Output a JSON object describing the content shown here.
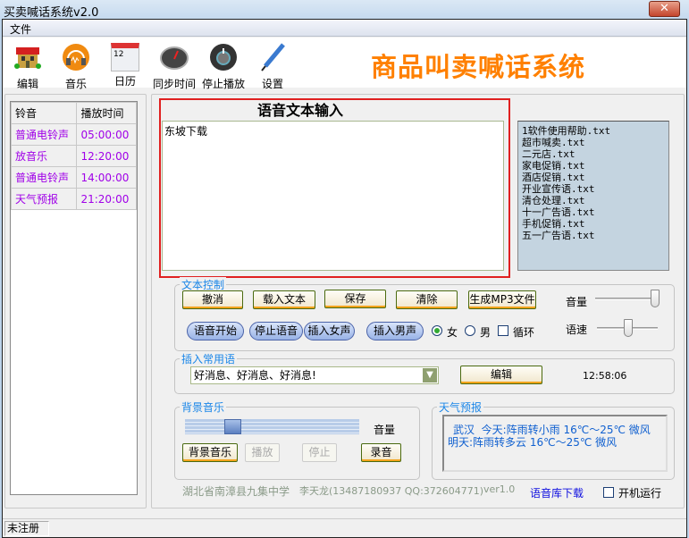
{
  "window": {
    "title": "买卖喊话系统v2.0",
    "close": "✕"
  },
  "menu": {
    "file": "文件"
  },
  "toolbar": {
    "items": [
      {
        "label": "编辑",
        "icon": "house-icon"
      },
      {
        "label": "音乐",
        "icon": "headphones-icon"
      },
      {
        "label": "日历",
        "icon": "calendar-icon"
      },
      {
        "label": "同步时间",
        "icon": "gauge-icon"
      },
      {
        "label": "停止播放",
        "icon": "power-icon"
      },
      {
        "label": "设置",
        "icon": "pen-icon"
      }
    ],
    "brand": "商品叫卖喊话系统",
    "calendar_day": "12"
  },
  "schedule": {
    "headers": [
      "铃音",
      "播放时间"
    ],
    "rows": [
      [
        "普通电铃声",
        "05:00:00"
      ],
      [
        "放音乐",
        "12:20:00"
      ],
      [
        "普通电铃声",
        "14:00:00"
      ],
      [
        "天气预报",
        "21:20:00"
      ]
    ]
  },
  "editor": {
    "title": "语音文本输入",
    "text": "东坡下载"
  },
  "files": [
    "1软件使用帮助.txt",
    "超市喊卖.txt",
    "二元店.txt",
    "家电促销.txt",
    "酒店促销.txt",
    "开业宣传语.txt",
    "清仓处理.txt",
    "十一广告语.txt",
    "手机促销.txt",
    "五一广告语.txt"
  ],
  "text_control": {
    "label": "文本控制",
    "buttons": [
      "撤消",
      "载入文本",
      "保存",
      "清除",
      "生成MP3文件"
    ],
    "pills": [
      "语音开始",
      "停止语音",
      "插入女声",
      "插入男声"
    ],
    "female": "女",
    "male": "男",
    "loop": "循环",
    "volume": "音量",
    "speed": "语速",
    "volume_level": 1.0,
    "speed_level": 0.5,
    "gender_selected": "女",
    "loop_checked": false
  },
  "phrases": {
    "label": "插入常用语",
    "selected": "好消息、好消息、好消息!",
    "edit": "编辑",
    "clock": "12:58:06"
  },
  "bgm": {
    "label": "背景音乐",
    "volume": "音量",
    "volume_level": 0.25,
    "buttons": [
      "背景音乐",
      "播放",
      "停止",
      "录音"
    ]
  },
  "weather": {
    "label": "天气预报",
    "line1": "武汉  今天:阵雨转小雨 16℃～25℃ 微风",
    "line2": "明天:阵雨转多云 16℃～25℃ 微风"
  },
  "footer": {
    "school": "湖北省南漳县九集中学",
    "author": "李天龙(13487180937 QQ:372604771)",
    "version": "ver1.0",
    "download": "语音库下载",
    "autostart": "开机运行"
  },
  "status": {
    "text": "未注册"
  }
}
